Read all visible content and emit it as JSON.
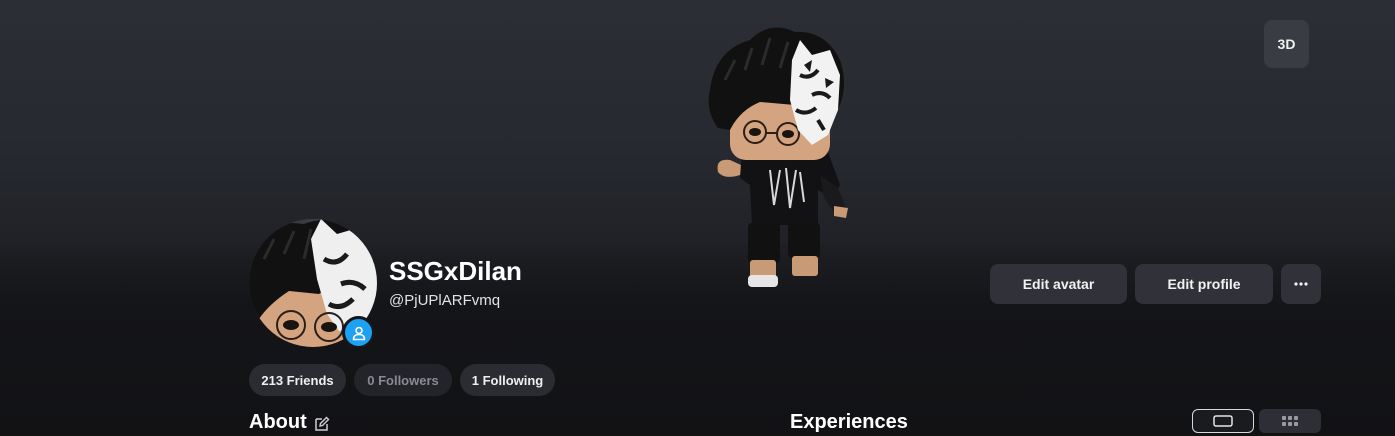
{
  "header": {
    "view_mode_label": "3D"
  },
  "profile": {
    "display_name": "SSGxDilan",
    "username": "@PjUPlARFvmq",
    "presence": "online-icon"
  },
  "actions": {
    "edit_avatar": "Edit avatar",
    "edit_profile": "Edit profile",
    "more": "···"
  },
  "stats": {
    "friends": "213 Friends",
    "followers": "0 Followers",
    "following": "1 Following"
  },
  "sections": {
    "about": "About",
    "experiences": "Experiences"
  },
  "colors": {
    "presence": "#1da1f2",
    "button_bg": "#303139",
    "page_bg": "#121215"
  }
}
